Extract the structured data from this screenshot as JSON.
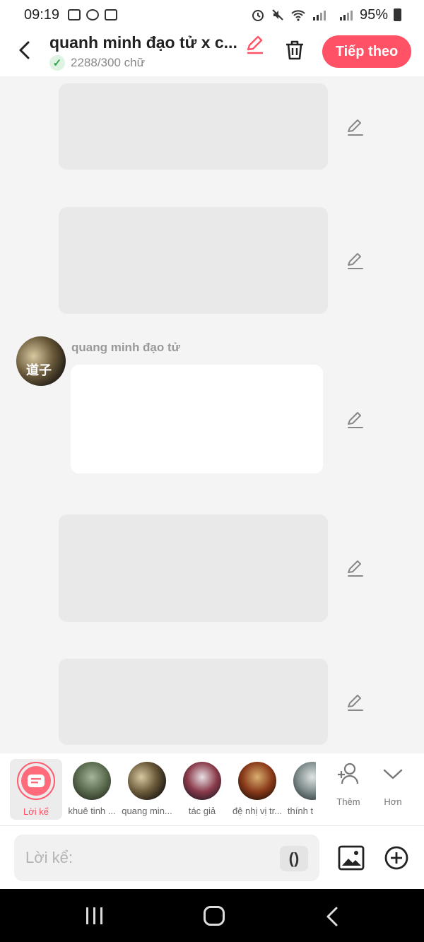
{
  "status": {
    "time": "09:19",
    "battery": "95%"
  },
  "header": {
    "title": "quanh minh đạo tử x c...",
    "word_count": "2288/300 chữ",
    "next_label": "Tiếp theo",
    "accent": "#ff5266"
  },
  "messages": [
    {
      "type": "narration",
      "text": ""
    },
    {
      "type": "narration",
      "text": ""
    },
    {
      "type": "character",
      "speaker": "quang minh đạo tử",
      "avatar_glyph": "道子",
      "text": ""
    },
    {
      "type": "narration",
      "text": ""
    },
    {
      "type": "narration",
      "text": ""
    }
  ],
  "characters": [
    {
      "label": "Lời kể",
      "icon": "narration-icon"
    },
    {
      "label": "khuê tinh ..."
    },
    {
      "label": "quang min..."
    },
    {
      "label": "tác giả"
    },
    {
      "label": "đệ nhị vị tr..."
    },
    {
      "label": "thính t"
    }
  ],
  "actions": {
    "more_label": "Thêm",
    "less_label": "Hơn"
  },
  "input": {
    "placeholder": "Lời kể:",
    "paren": "()"
  }
}
